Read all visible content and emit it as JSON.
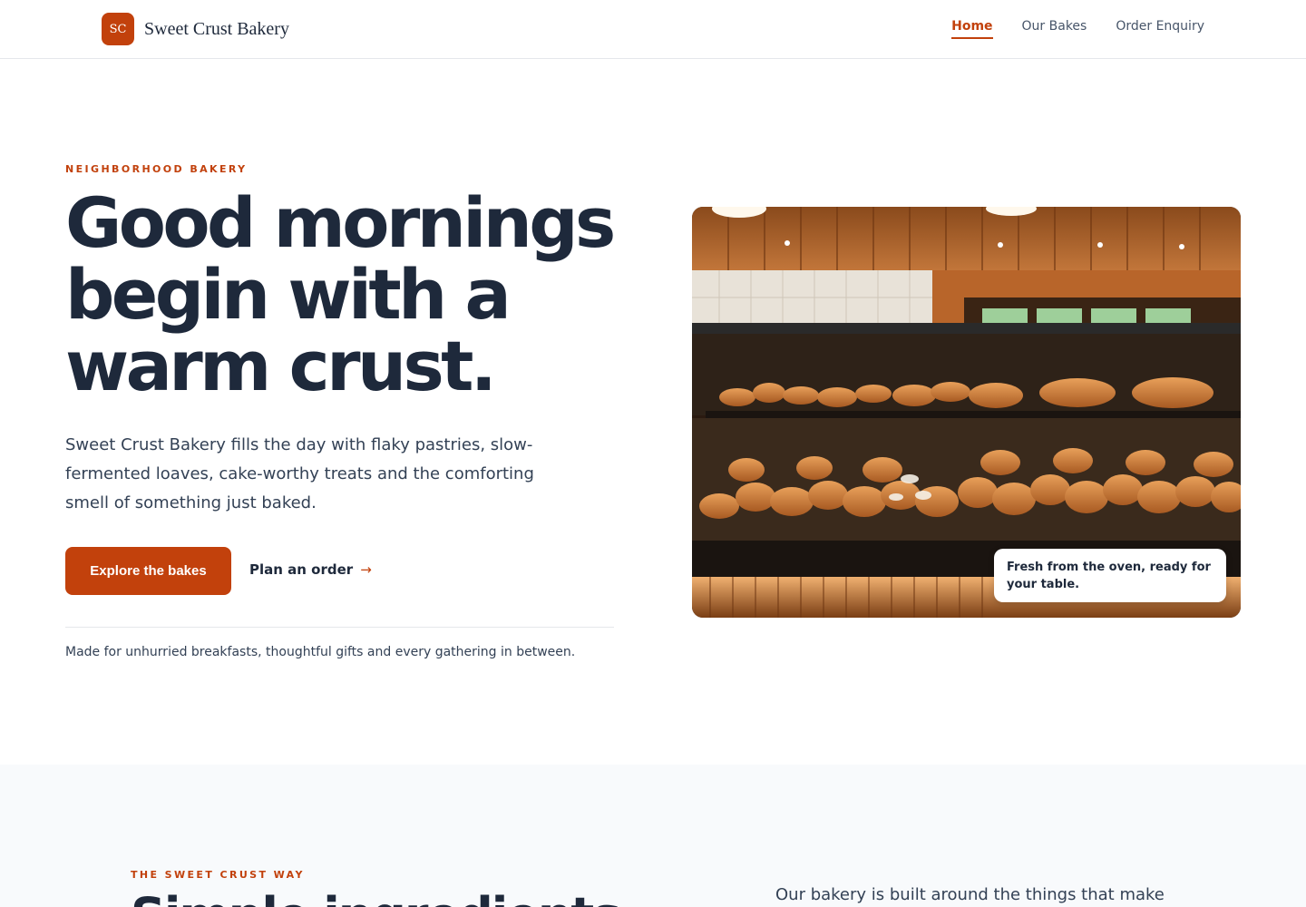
{
  "header": {
    "logo_initials": "SC",
    "brand_name": "Sweet Crust Bakery",
    "nav": [
      {
        "label": "Home",
        "active": true
      },
      {
        "label": "Our Bakes",
        "active": false
      },
      {
        "label": "Order Enquiry",
        "active": false
      }
    ]
  },
  "hero": {
    "eyebrow": "NEIGHBORHOOD BAKERY",
    "title_lines": [
      "Good mornings",
      "begin with a",
      "warm crust."
    ],
    "description": "Sweet Crust Bakery fills the day with flaky pastries, slow-fermented loaves, cake-worthy treats and the comforting smell of something just baked.",
    "primary_cta": "Explore the bakes",
    "secondary_cta": "Plan an order",
    "secondary_cta_icon": "arrow-right-icon",
    "note": "Made for unhurried breakfasts, thoughtful gifts and every gathering in between.",
    "image_caption": "Fresh from the oven, ready for your table."
  },
  "section2": {
    "eyebrow": "THE SWEET CRUST WAY",
    "title": "Simple ingredients",
    "text": "Our bakery is built around the things that make people"
  },
  "colors": {
    "accent": "#c2410c",
    "heading": "#1e293b",
    "body": "#334155"
  }
}
